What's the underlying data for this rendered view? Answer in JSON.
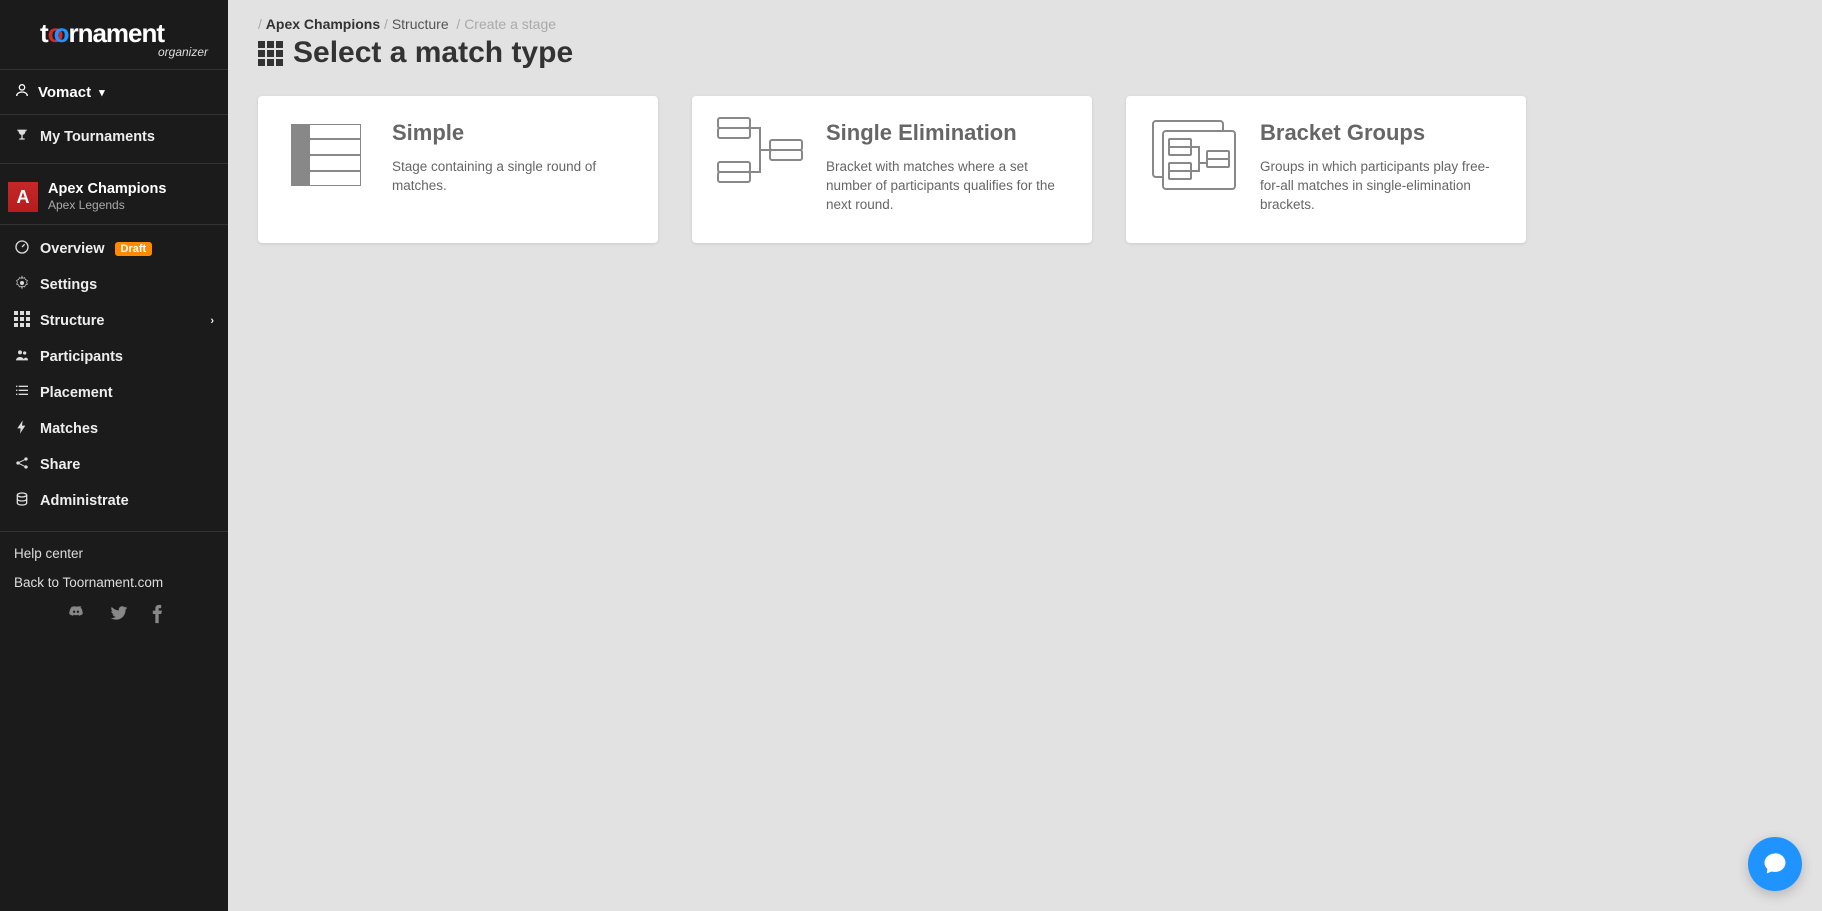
{
  "brand": {
    "name": "toornament",
    "subtitle": "organizer"
  },
  "user": {
    "name": "Vomact"
  },
  "topNav": {
    "myTournaments": "My Tournaments"
  },
  "tournament": {
    "name": "Apex Champions",
    "game": "Apex Legends",
    "gameInitial": "A"
  },
  "nav": {
    "overview": "Overview",
    "overviewBadge": "Draft",
    "settings": "Settings",
    "structure": "Structure",
    "participants": "Participants",
    "placement": "Placement",
    "matches": "Matches",
    "share": "Share",
    "administrate": "Administrate"
  },
  "footer": {
    "helpCenter": "Help center",
    "backToSite": "Back to Toornament.com"
  },
  "breadcrumb": {
    "tournament": "Apex Champions",
    "section": "Structure",
    "current": "Create a stage"
  },
  "page": {
    "title": "Select a match type"
  },
  "cards": [
    {
      "title": "Simple",
      "desc": "Stage containing a single round of matches."
    },
    {
      "title": "Single Elimination",
      "desc": "Bracket with matches where a set number of participants qualifies for the next round."
    },
    {
      "title": "Bracket Groups",
      "desc": "Groups in which participants play free-for-all matches in single-elimination brackets."
    }
  ]
}
